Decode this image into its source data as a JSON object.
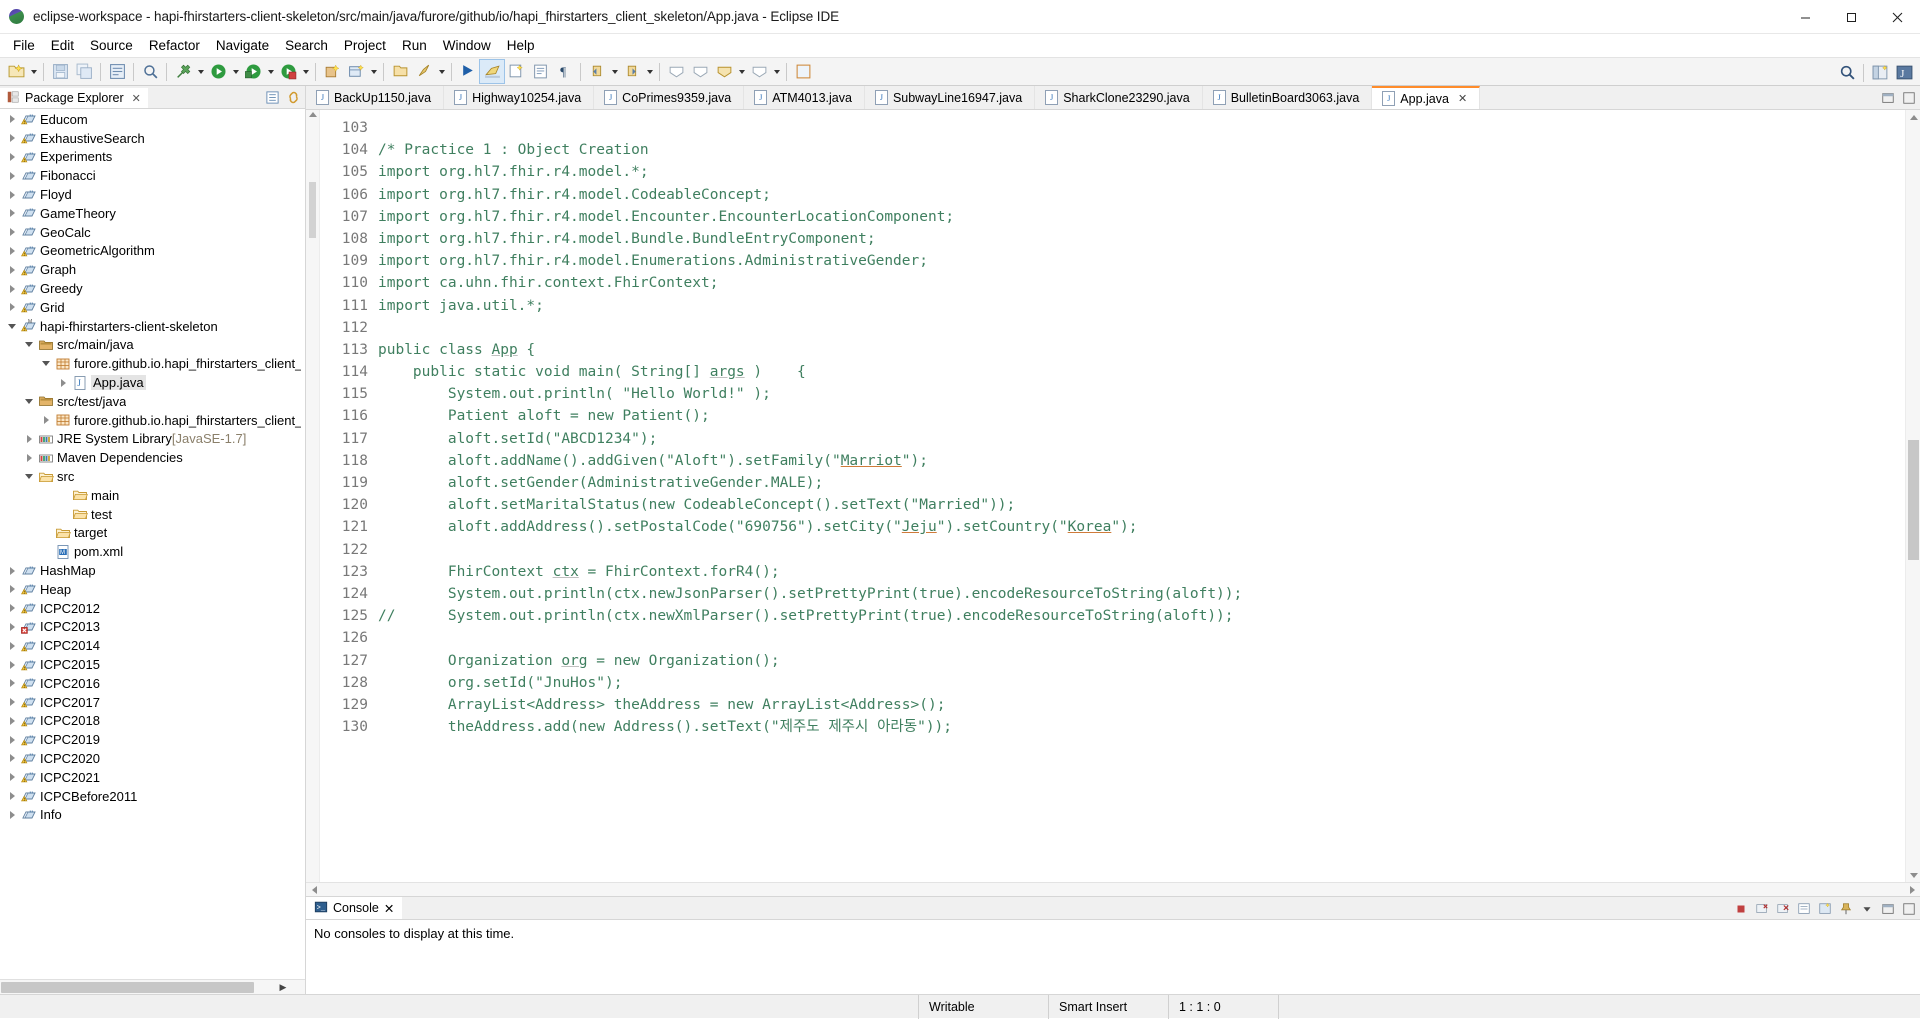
{
  "window": {
    "title": "eclipse-workspace - hapi-fhirstarters-client-skeleton/src/main/java/furore/github/io/hapi_fhirstarters_client_skeleton/App.java - Eclipse IDE",
    "minimize_label": "–",
    "maximize_label": "❐",
    "close_label": "✕"
  },
  "menubar": {
    "items": [
      {
        "label": "File"
      },
      {
        "label": "Edit"
      },
      {
        "label": "Source"
      },
      {
        "label": "Refactor"
      },
      {
        "label": "Navigate"
      },
      {
        "label": "Search"
      },
      {
        "label": "Project"
      },
      {
        "label": "Run"
      },
      {
        "label": "Window"
      },
      {
        "label": "Help"
      }
    ]
  },
  "toolbar": {
    "buttons": [
      {
        "name": "new-wizard-icon",
        "arrow": true
      },
      {
        "name": "save-icon",
        "arrow": false
      },
      {
        "name": "save-all-icon",
        "arrow": false
      },
      {
        "name": "print-icon",
        "arrow": false
      },
      {
        "name": "toggle-mark-occurrences-icon",
        "arrow": false
      },
      {
        "name": "external-tools-icon",
        "arrow": true
      },
      {
        "name": "run-icon",
        "arrow": true
      },
      {
        "name": "debug-icon",
        "arrow": true
      },
      {
        "name": "coverage-icon",
        "arrow": true
      },
      {
        "name": "new-java-project-icon",
        "arrow": false
      },
      {
        "name": "new-package-icon",
        "arrow": true
      },
      {
        "name": "open-type-icon",
        "arrow": false
      },
      {
        "name": "search-tool-icon",
        "arrow": true
      },
      {
        "name": "skip-breakpoints-icon",
        "arrow": false
      },
      {
        "name": "pin-editor-icon",
        "arrow": false
      },
      {
        "name": "next-annotation-icon",
        "arrow": false
      },
      {
        "name": "previous-annotation-icon",
        "arrow": false
      },
      {
        "name": "last-edit-location-icon",
        "arrow": false
      },
      {
        "name": "back-icon",
        "arrow": true
      },
      {
        "name": "forward-icon",
        "arrow": true
      }
    ],
    "right_buttons": [
      {
        "name": "quick-access-search-icon"
      },
      {
        "name": "open-perspective-icon"
      },
      {
        "name": "java-perspective-icon"
      }
    ]
  },
  "explorer": {
    "tab_label": "Package Explorer",
    "tab_close": "✕",
    "view_buttons": [
      {
        "name": "collapse-all-icon"
      },
      {
        "name": "link-with-editor-icon"
      },
      {
        "name": "view-menu-icon"
      },
      {
        "name": "minimize-view-icon"
      },
      {
        "name": "maximize-view-icon"
      }
    ],
    "tree": [
      {
        "label": "Educom",
        "indent": 0,
        "twist": "closed",
        "icon": "java-project-warn"
      },
      {
        "label": "ExhaustiveSearch",
        "indent": 0,
        "twist": "closed",
        "icon": "java-project-warn"
      },
      {
        "label": "Experiments",
        "indent": 0,
        "twist": "closed",
        "icon": "java-project-warn"
      },
      {
        "label": "Fibonacci",
        "indent": 0,
        "twist": "closed",
        "icon": "java-project"
      },
      {
        "label": "Floyd",
        "indent": 0,
        "twist": "closed",
        "icon": "java-project"
      },
      {
        "label": "GameTheory",
        "indent": 0,
        "twist": "closed",
        "icon": "java-project"
      },
      {
        "label": "GeoCalc",
        "indent": 0,
        "twist": "closed",
        "icon": "java-project"
      },
      {
        "label": "GeometricAlgorithm",
        "indent": 0,
        "twist": "closed",
        "icon": "java-project-warn"
      },
      {
        "label": "Graph",
        "indent": 0,
        "twist": "closed",
        "icon": "java-project-warn"
      },
      {
        "label": "Greedy",
        "indent": 0,
        "twist": "closed",
        "icon": "java-project-warn"
      },
      {
        "label": "Grid",
        "indent": 0,
        "twist": "closed",
        "icon": "java-project-warn"
      },
      {
        "label": "hapi-fhirstarters-client-skeleton",
        "indent": 0,
        "twist": "open",
        "icon": "maven-project-warn"
      },
      {
        "label": "src/main/java",
        "indent": 1,
        "twist": "open",
        "icon": "source-folder"
      },
      {
        "label": "furore.github.io.hapi_fhirstarters_client_s",
        "indent": 2,
        "twist": "open",
        "icon": "package"
      },
      {
        "label": "App.java",
        "indent": 3,
        "twist": "closed",
        "icon": "compilation-unit",
        "selected": true
      },
      {
        "label": "src/test/java",
        "indent": 1,
        "twist": "open",
        "icon": "source-folder"
      },
      {
        "label": "furore.github.io.hapi_fhirstarters_client_s",
        "indent": 2,
        "twist": "closed",
        "icon": "package"
      },
      {
        "label": "JRE System Library",
        "sub": "[JavaSE-1.7]",
        "indent": 1,
        "twist": "closed",
        "icon": "library"
      },
      {
        "label": "Maven Dependencies",
        "indent": 1,
        "twist": "closed",
        "icon": "library"
      },
      {
        "label": "src",
        "indent": 1,
        "twist": "open",
        "icon": "folder"
      },
      {
        "label": "main",
        "indent": 3,
        "twist": "none",
        "icon": "folder"
      },
      {
        "label": "test",
        "indent": 3,
        "twist": "none",
        "icon": "folder"
      },
      {
        "label": "target",
        "indent": 2,
        "twist": "none",
        "icon": "folder"
      },
      {
        "label": "pom.xml",
        "indent": 2,
        "twist": "none",
        "icon": "xml-file"
      },
      {
        "label": "HashMap",
        "indent": 0,
        "twist": "closed",
        "icon": "java-project"
      },
      {
        "label": "Heap",
        "indent": 0,
        "twist": "closed",
        "icon": "java-project-warn"
      },
      {
        "label": "ICPC2012",
        "indent": 0,
        "twist": "closed",
        "icon": "java-project-warn"
      },
      {
        "label": "ICPC2013",
        "indent": 0,
        "twist": "closed",
        "icon": "java-project-error"
      },
      {
        "label": "ICPC2014",
        "indent": 0,
        "twist": "closed",
        "icon": "java-project-warn"
      },
      {
        "label": "ICPC2015",
        "indent": 0,
        "twist": "closed",
        "icon": "java-project-warn"
      },
      {
        "label": "ICPC2016",
        "indent": 0,
        "twist": "closed",
        "icon": "java-project-warn"
      },
      {
        "label": "ICPC2017",
        "indent": 0,
        "twist": "closed",
        "icon": "java-project-warn"
      },
      {
        "label": "ICPC2018",
        "indent": 0,
        "twist": "closed",
        "icon": "java-project-warn"
      },
      {
        "label": "ICPC2019",
        "indent": 0,
        "twist": "closed",
        "icon": "java-project-warn"
      },
      {
        "label": "ICPC2020",
        "indent": 0,
        "twist": "closed",
        "icon": "java-project-warn"
      },
      {
        "label": "ICPC2021",
        "indent": 0,
        "twist": "closed",
        "icon": "java-project-warn"
      },
      {
        "label": "ICPCBefore2011",
        "indent": 0,
        "twist": "closed",
        "icon": "java-project-warn"
      },
      {
        "label": "Info",
        "indent": 0,
        "twist": "closed",
        "icon": "java-project"
      }
    ]
  },
  "editor": {
    "tabs": [
      {
        "label": "BackUp1150.java",
        "active": false
      },
      {
        "label": "Highway10254.java",
        "active": false
      },
      {
        "label": "CoPrimes9359.java",
        "active": false
      },
      {
        "label": "ATM4013.java",
        "active": false
      },
      {
        "label": "SubwayLine16947.java",
        "active": false
      },
      {
        "label": "SharkClone23290.java",
        "active": false
      },
      {
        "label": "BulletinBoard3063.java",
        "active": false
      },
      {
        "label": "App.java",
        "active": true,
        "close": "✕"
      }
    ],
    "view_buttons": [
      {
        "name": "minimize-editor-icon"
      },
      {
        "name": "maximize-editor-icon"
      }
    ],
    "first_line_number": 103,
    "lines": [
      {
        "n": 103,
        "segments": [
          {
            "t": "",
            "c": "plain"
          }
        ]
      },
      {
        "n": 104,
        "segments": [
          {
            "t": "/* Practice 1 : Object Creation",
            "c": "cmt"
          }
        ]
      },
      {
        "n": 105,
        "segments": [
          {
            "t": "import org.hl7.fhir.r4.model.*;",
            "c": "cmt"
          }
        ]
      },
      {
        "n": 106,
        "segments": [
          {
            "t": "import org.hl7.fhir.r4.model.CodeableConcept;",
            "c": "cmt"
          }
        ]
      },
      {
        "n": 107,
        "segments": [
          {
            "t": "import org.hl7.fhir.r4.model.Encounter.EncounterLocationComponent;",
            "c": "cmt"
          }
        ]
      },
      {
        "n": 108,
        "segments": [
          {
            "t": "import org.hl7.fhir.r4.model.Bundle.BundleEntryComponent;",
            "c": "cmt"
          }
        ]
      },
      {
        "n": 109,
        "segments": [
          {
            "t": "import org.hl7.fhir.r4.model.Enumerations.AdministrativeGender;",
            "c": "cmt"
          }
        ]
      },
      {
        "n": 110,
        "segments": [
          {
            "t": "import ca.uhn.fhir.context.FhirContext;",
            "c": "cmt"
          }
        ]
      },
      {
        "n": 111,
        "segments": [
          {
            "t": "import java.util.*;",
            "c": "cmt"
          }
        ]
      },
      {
        "n": 112,
        "segments": [
          {
            "t": "",
            "c": "plain"
          }
        ]
      },
      {
        "n": 113,
        "segments": [
          {
            "t": "public class ",
            "c": "cmt"
          },
          {
            "t": "App",
            "c": "cmt und"
          },
          {
            "t": " {",
            "c": "cmt"
          }
        ]
      },
      {
        "n": 114,
        "segments": [
          {
            "t": "    public static void main( String[] ",
            "c": "cmt"
          },
          {
            "t": "args",
            "c": "cmt und"
          },
          {
            "t": " )    {",
            "c": "cmt"
          }
        ]
      },
      {
        "n": 115,
        "segments": [
          {
            "t": "        System.out.println( \"Hello World!\" );",
            "c": "cmt"
          }
        ]
      },
      {
        "n": 116,
        "segments": [
          {
            "t": "        Patient aloft = new Patient();",
            "c": "cmt"
          }
        ]
      },
      {
        "n": 117,
        "segments": [
          {
            "t": "        aloft.setId(\"ABCD1234\");",
            "c": "cmt"
          }
        ]
      },
      {
        "n": 118,
        "segments": [
          {
            "t": "        aloft.addName().addGiven(\"Aloft\").setFamily(\"",
            "c": "cmt"
          },
          {
            "t": "Marriot",
            "c": "cmt undr"
          },
          {
            "t": "\");",
            "c": "cmt"
          }
        ]
      },
      {
        "n": 119,
        "segments": [
          {
            "t": "        aloft.setGender(AdministrativeGender.MALE);",
            "c": "cmt"
          }
        ]
      },
      {
        "n": 120,
        "segments": [
          {
            "t": "        aloft.setMaritalStatus(new CodeableConcept().setText(\"Married\"));",
            "c": "cmt"
          }
        ]
      },
      {
        "n": 121,
        "segments": [
          {
            "t": "        aloft.addAddress().setPostalCode(\"690756\").setCity(\"",
            "c": "cmt"
          },
          {
            "t": "Jeju",
            "c": "cmt undr"
          },
          {
            "t": "\").setCountry(\"",
            "c": "cmt"
          },
          {
            "t": "Korea",
            "c": "cmt undr"
          },
          {
            "t": "\");",
            "c": "cmt"
          }
        ]
      },
      {
        "n": 122,
        "segments": [
          {
            "t": "",
            "c": "plain"
          }
        ]
      },
      {
        "n": 123,
        "segments": [
          {
            "t": "        FhirContext ",
            "c": "cmt"
          },
          {
            "t": "ctx",
            "c": "cmt und"
          },
          {
            "t": " = FhirContext.forR4();",
            "c": "cmt"
          }
        ]
      },
      {
        "n": 124,
        "segments": [
          {
            "t": "        System.out.println(ctx.newJsonParser().setPrettyPrint(true).encodeResourceToString(aloft));",
            "c": "cmt"
          }
        ]
      },
      {
        "n": 125,
        "segments": [
          {
            "t": "//      System.out.println(ctx.newXmlParser().setPrettyPrint(true).encodeResourceToString(aloft));",
            "c": "cmt"
          }
        ]
      },
      {
        "n": 126,
        "segments": [
          {
            "t": "",
            "c": "plain"
          }
        ]
      },
      {
        "n": 127,
        "segments": [
          {
            "t": "        Organization ",
            "c": "cmt"
          },
          {
            "t": "org",
            "c": "cmt und"
          },
          {
            "t": " = new Organization();",
            "c": "cmt"
          }
        ]
      },
      {
        "n": 128,
        "segments": [
          {
            "t": "        org.setId(\"JnuHos\");",
            "c": "cmt"
          }
        ]
      },
      {
        "n": 129,
        "segments": [
          {
            "t": "        ArrayList<Address> theAddress = new ArrayList<Address>();",
            "c": "cmt"
          }
        ]
      },
      {
        "n": 130,
        "segments": [
          {
            "t": "        theAddress.add(new Address().setText(\"제주도 제주시 아라동\"));",
            "c": "cmt"
          }
        ]
      }
    ]
  },
  "console": {
    "tab_label": "Console",
    "tab_close": "✕",
    "empty_message": "No consoles to display at this time.",
    "view_buttons": [
      {
        "name": "terminate-icon"
      },
      {
        "name": "remove-launch-icon"
      },
      {
        "name": "remove-all-terminated-icon"
      },
      {
        "name": "display-selected-console-icon"
      },
      {
        "name": "open-console-icon"
      },
      {
        "name": "pin-console-icon"
      },
      {
        "name": "console-view-menu-icon"
      },
      {
        "name": "minimize-console-icon"
      },
      {
        "name": "maximize-console-icon"
      }
    ]
  },
  "statusbar": {
    "writable": "Writable",
    "insert_mode": "Smart Insert",
    "caret_position": "1 : 1 : 0"
  },
  "colors": {
    "accent_tab": "#ff8c2b",
    "comment_green": "#3f7f5f",
    "keyword_purple": "#7f0055",
    "string_blue": "#2a00ff",
    "chrome_gray": "#f0f0f0",
    "selection_gray": "#e4e4e4",
    "sublabel_tan": "#8a7f6a"
  }
}
